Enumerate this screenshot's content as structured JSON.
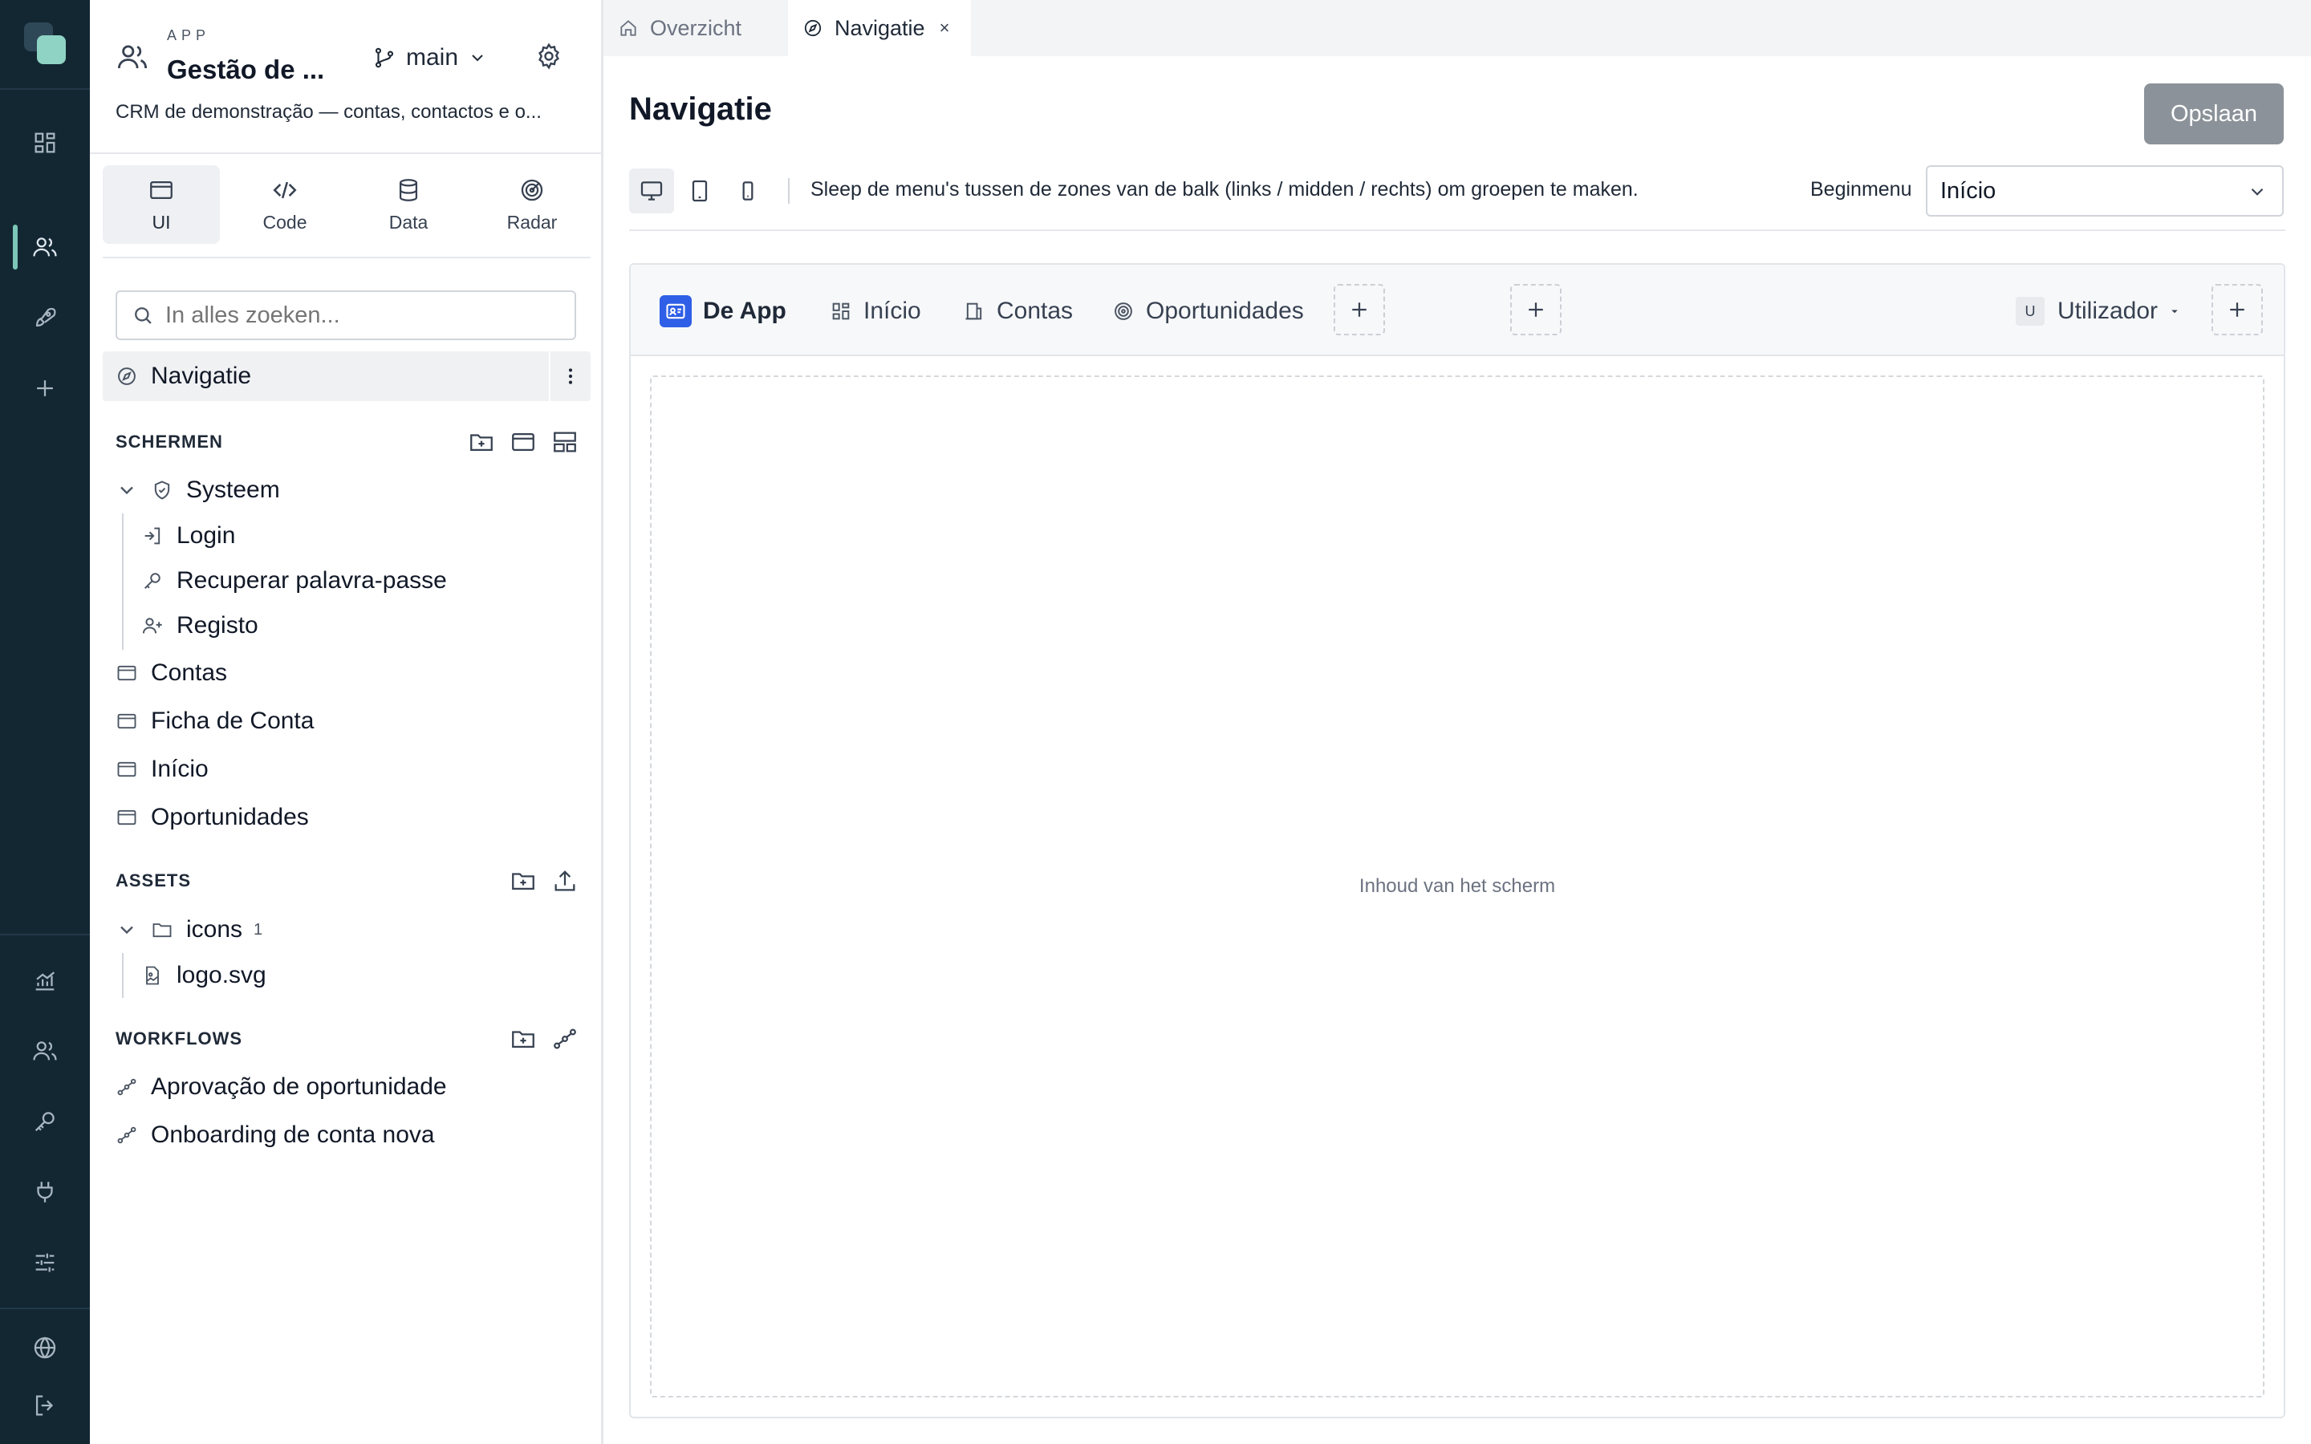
{
  "colors": {
    "rail_bg": "#132733",
    "rail_accent": "#7cc7b8",
    "brand_blue": "#2f5fe6",
    "save_button_bg": "#8b9299"
  },
  "rail": {
    "icons": [
      "app-logo-icon",
      "dashboard-icon",
      "users-icon",
      "rocket-icon",
      "plus-icon",
      "analytics-icon",
      "team-icon",
      "key-icon",
      "plug-icon",
      "sliders-icon",
      "globe-icon",
      "logout-icon"
    ],
    "active_icon": "users-icon"
  },
  "sidebar": {
    "app_kicker": "APP",
    "app_name": "Gestão de ...",
    "branch": "main",
    "description": "CRM de demonstração — contas, contactos e o...",
    "modes": [
      {
        "label": "UI",
        "icon": "window-icon",
        "active": true
      },
      {
        "label": "Code",
        "icon": "code-icon",
        "active": false
      },
      {
        "label": "Data",
        "icon": "database-icon",
        "active": false
      },
      {
        "label": "Radar",
        "icon": "radar-icon",
        "active": false
      }
    ],
    "search_placeholder": "In alles zoeken...",
    "selected_item": "Navigatie",
    "screens": {
      "heading": "SCHERMEN",
      "group": "Systeem",
      "group_children": [
        "Login",
        "Recuperar palavra-passe",
        "Registo"
      ],
      "items": [
        "Contas",
        "Ficha de Conta",
        "Início",
        "Oportunidades"
      ]
    },
    "assets": {
      "heading": "ASSETS",
      "folder": "icons",
      "folder_count": "1",
      "file": "logo.svg"
    },
    "workflows": {
      "heading": "WORKFLOWS",
      "items": [
        "Aprovação de oportunidade",
        "Onboarding de conta nova"
      ]
    }
  },
  "tabs": [
    {
      "label": "Overzicht",
      "icon": "home-icon",
      "active": false
    },
    {
      "label": "Navigatie",
      "icon": "compass-icon",
      "active": true,
      "close": "×"
    }
  ],
  "page": {
    "title": "Navigatie",
    "save_label": "Opslaan",
    "hint": "Sleep de menu's tussen de zones van de balk (links / midden / rechts) om groepen te maken.",
    "start_menu_label": "Beginmenu",
    "start_menu_value": "Início",
    "devices": [
      "desktop-icon",
      "tablet-icon",
      "phone-icon"
    ],
    "active_device": "desktop-icon"
  },
  "preview": {
    "brand": "De App",
    "nav_items": [
      {
        "label": "Início",
        "icon": "grid-icon"
      },
      {
        "label": "Contas",
        "icon": "building-icon"
      },
      {
        "label": "Oportunidades",
        "icon": "target-icon"
      }
    ],
    "user_initial": "U",
    "user_label": "Utilizador",
    "content_placeholder": "Inhoud van het scherm"
  }
}
